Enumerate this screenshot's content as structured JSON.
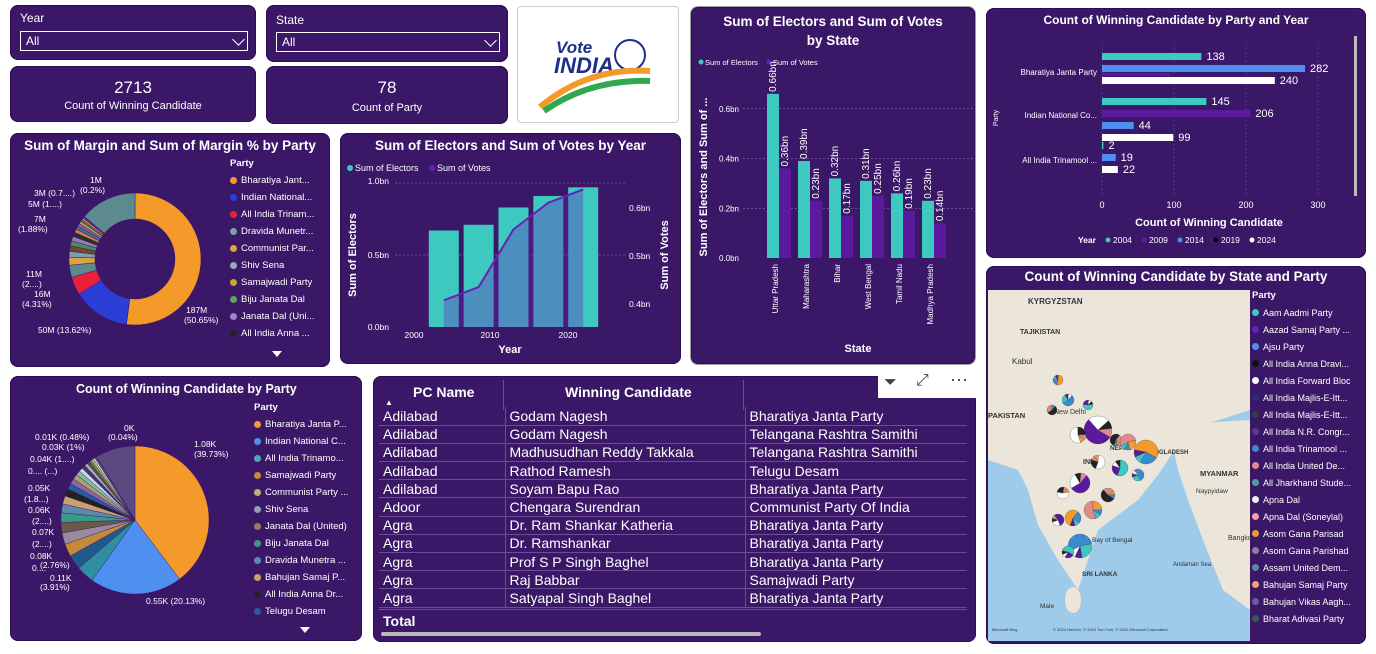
{
  "slicers": {
    "year": {
      "label": "Year",
      "value": "All"
    },
    "state": {
      "label": "State",
      "value": "All"
    }
  },
  "kpis": {
    "candidates": {
      "value": "2713",
      "label": "Count of Winning Candidate"
    },
    "parties": {
      "value": "78",
      "label": "Count of Party"
    }
  },
  "logo": {
    "line1": "Vote",
    "line2": "INDIA"
  },
  "margin_donut": {
    "title": "Sum of Margin and Sum of Margin % by Party",
    "legend_title": "Party",
    "legend": [
      "Bharatiya Jant...",
      "Indian National...",
      "All India Trinam...",
      "Dravida Munetr...",
      "Communist Par...",
      "Shiv Sena",
      "Samajwadi Party",
      "Biju Janata Dal",
      "Janata Dal (Uni...",
      "All India Anna ..."
    ],
    "labels": [
      "187M",
      "(50.65%)",
      "50M (13.62%)",
      "16M",
      "(4.31%)",
      "11M",
      "(2....)",
      "7M",
      "(1.88%)",
      "5M (1....)",
      "3M (0.7....)",
      "1M",
      "(0.2%)"
    ]
  },
  "electors_year": {
    "title": "Sum of Electors and Sum of Votes by Year",
    "legend": [
      "Sum of Electors",
      "Sum of Votes"
    ],
    "ylabel": "Sum of Electors",
    "y2label": "Sum of Votes",
    "xlabel": "Year",
    "yticks": [
      "0.0bn",
      "0.5bn",
      "1.0bn"
    ],
    "y2ticks": [
      "0.4bn",
      "0.5bn",
      "0.6bn"
    ],
    "xticks": [
      "2000",
      "2010",
      "2020"
    ]
  },
  "electors_state": {
    "title": "Sum of Electors and Sum of Votes by State",
    "legend": [
      "Sum of Electors",
      "Sum of Votes"
    ],
    "ylabel": "Sum of Electors and Sum of ...",
    "xlabel": "State",
    "yticks": [
      "0.0bn",
      "0.2bn",
      "0.4bn",
      "0.6bn"
    ],
    "states": [
      "Uttar Pradesh",
      "Maharashtra",
      "Bihar",
      "West Bengal",
      "Tamil Nadu",
      "Madhya Pradesh"
    ],
    "elector_labels": [
      "0.66bn",
      "0.39bn",
      "0.32bn",
      "0.31bn",
      "0.26bn",
      "0.23bn"
    ],
    "vote_labels": [
      "0.36bn",
      "0.23bn",
      "0.17bn",
      "0.25bn",
      "0.19bn",
      "0.14bn"
    ]
  },
  "winning_party_year": {
    "title": "Count of Winning Candidate by Party and Year",
    "ylabel": "Party",
    "xlabel": "Count of Winning Candidate",
    "xticks": [
      "0",
      "100",
      "200",
      "300"
    ],
    "parties": [
      "Bharatiya Janta Party",
      "Indian National Co...",
      "All India Trinamool ..."
    ],
    "legend_title": "Year",
    "years": [
      "2004",
      "2009",
      "2014",
      "2019",
      "2024"
    ]
  },
  "party_pie": {
    "title": "Count of Winning Candidate by Party",
    "legend_title": "Party",
    "legend": [
      "Bharatiya Janta P...",
      "Indian National C...",
      "All India Trinamo...",
      "Samajwadi Party",
      "Communist Party ...",
      "Shiv Sena",
      "Janata Dal (United)",
      "Biju Janata Dal",
      "Dravida Munetra ...",
      "Bahujan Samaj P...",
      "All India Anna Dr...",
      "Telugu Desam"
    ],
    "labels": [
      "1.08K",
      "(39.73%)",
      "0.55K (20.13%)",
      "0.11K",
      "(3.91%)",
      "0....",
      "(2.76%)",
      "0.08K",
      "(2....)",
      "0.07K",
      "(2....)",
      "0.06K",
      "(1.8...)",
      "0.05K",
      "0.... (...)",
      "0.04K (1....)",
      "0.03K (1%)",
      "0.01K (0.48%)",
      "0K",
      "(0.04%)"
    ]
  },
  "table": {
    "headers": [
      "PC Name",
      "Winning Candidate",
      "Party"
    ],
    "rows": [
      [
        "Adilabad",
        "Godam Nagesh",
        "Bharatiya Janta Party"
      ],
      [
        "Adilabad",
        "Godam Nagesh",
        "Telangana Rashtra Samithi"
      ],
      [
        "Adilabad",
        "Madhusudhan Reddy Takkala",
        "Telangana Rashtra Samithi"
      ],
      [
        "Adilabad",
        "Rathod Ramesh",
        "Telugu Desam"
      ],
      [
        "Adilabad",
        "Soyam Bapu Rao",
        "Bharatiya Janta Party"
      ],
      [
        "Adoor",
        "Chengara Surendran",
        "Communist Party Of India"
      ],
      [
        "Agra",
        "Dr. Ram Shankar Katheria",
        "Bharatiya Janta Party"
      ],
      [
        "Agra",
        "Dr. Ramshankar",
        "Bharatiya Janta Party"
      ],
      [
        "Agra",
        "Prof S P Singh Baghel",
        "Bharatiya Janta Party"
      ],
      [
        "Agra",
        "Raj Babbar",
        "Samajwadi Party"
      ],
      [
        "Agra",
        "Satyapal Singh Baghel",
        "Bharatiya Janta Party"
      ]
    ],
    "total_label": "Total"
  },
  "map": {
    "title": "Count of Winning Candidate by State and Party",
    "legend_title": "Party",
    "legend": [
      "Aam Aadmi Party",
      "Aazad Samaj Party ...",
      "Ajsu Party",
      "All India Anna Dravi...",
      "All India Forward Bloc",
      "All India Majlis-E-Itt...",
      "All India Majlis-E-Itt...",
      "All India N.R. Congr...",
      "All India Trinamool ...",
      "All India United De...",
      "All Jharkhand Stude...",
      "Apna Dal",
      "Apna Dal (Soneylal)",
      "Asom Gana Parisad",
      "Asom Gana Parishad",
      "Assam United Dem...",
      "Bahujan Samaj Party",
      "Bahujan Vikas Aagh...",
      "Bharat Adivasi Party"
    ],
    "places": [
      "KYRGYZSTAN",
      "TAJIKISTAN",
      "Kabul",
      "PAKISTAN",
      "New Delhi",
      "INDIA",
      "NEPAL",
      "BANGLADESH",
      "MYANMAR",
      "Naypyidaw",
      "Bay of Bengal",
      "SRI LANKA",
      "Bangkok",
      "Male",
      "Andaman Sea"
    ],
    "attribution": "© 2024 NavInfo, © 2024 Tom Tom, © 2024 Microsoft Corporation",
    "brand": "Microsoft Bing"
  },
  "colors": {
    "bg": "#3b1768",
    "teal": "#3dc9c0",
    "purple": "#5b1a9e",
    "orange": "#f39a2a",
    "blue": "#2b3fd6"
  }
}
